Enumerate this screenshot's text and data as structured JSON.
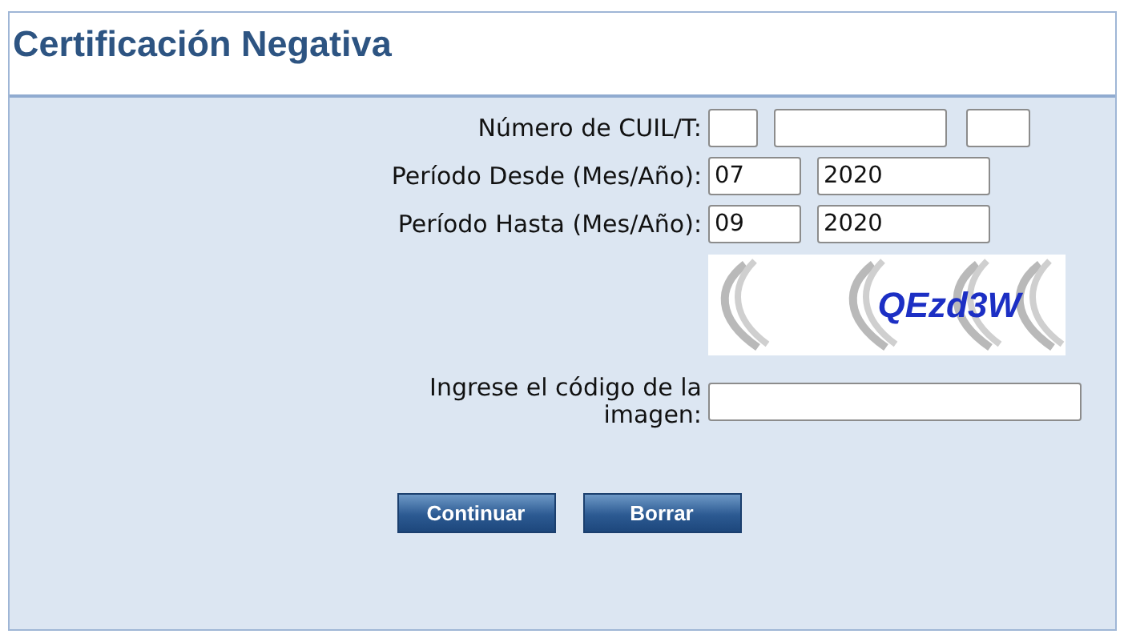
{
  "title": "Certificación Negativa",
  "rows": [
    {
      "label": "Número de CUIL/T:",
      "inputs": [
        {
          "kind": "tiny"
        },
        {
          "kind": "wide"
        },
        {
          "kind": "small"
        }
      ]
    },
    {
      "label": "Período Desde (Mes/Año):",
      "inputs": [
        {
          "kind": "month",
          "value": "07"
        },
        {
          "kind": "wide",
          "value": "2020"
        }
      ]
    },
    {
      "label": "Período Hasta (Mes/Año):",
      "inputs": [
        {
          "kind": "month",
          "value": "09"
        },
        {
          "kind": "wide",
          "value": "2020"
        }
      ]
    }
  ],
  "captcha": {
    "code": "QEzd3W"
  },
  "code_field": {
    "label": "Ingrese el código de la imagen:"
  },
  "buttons": [
    "Continuar",
    "Borrar"
  ]
}
